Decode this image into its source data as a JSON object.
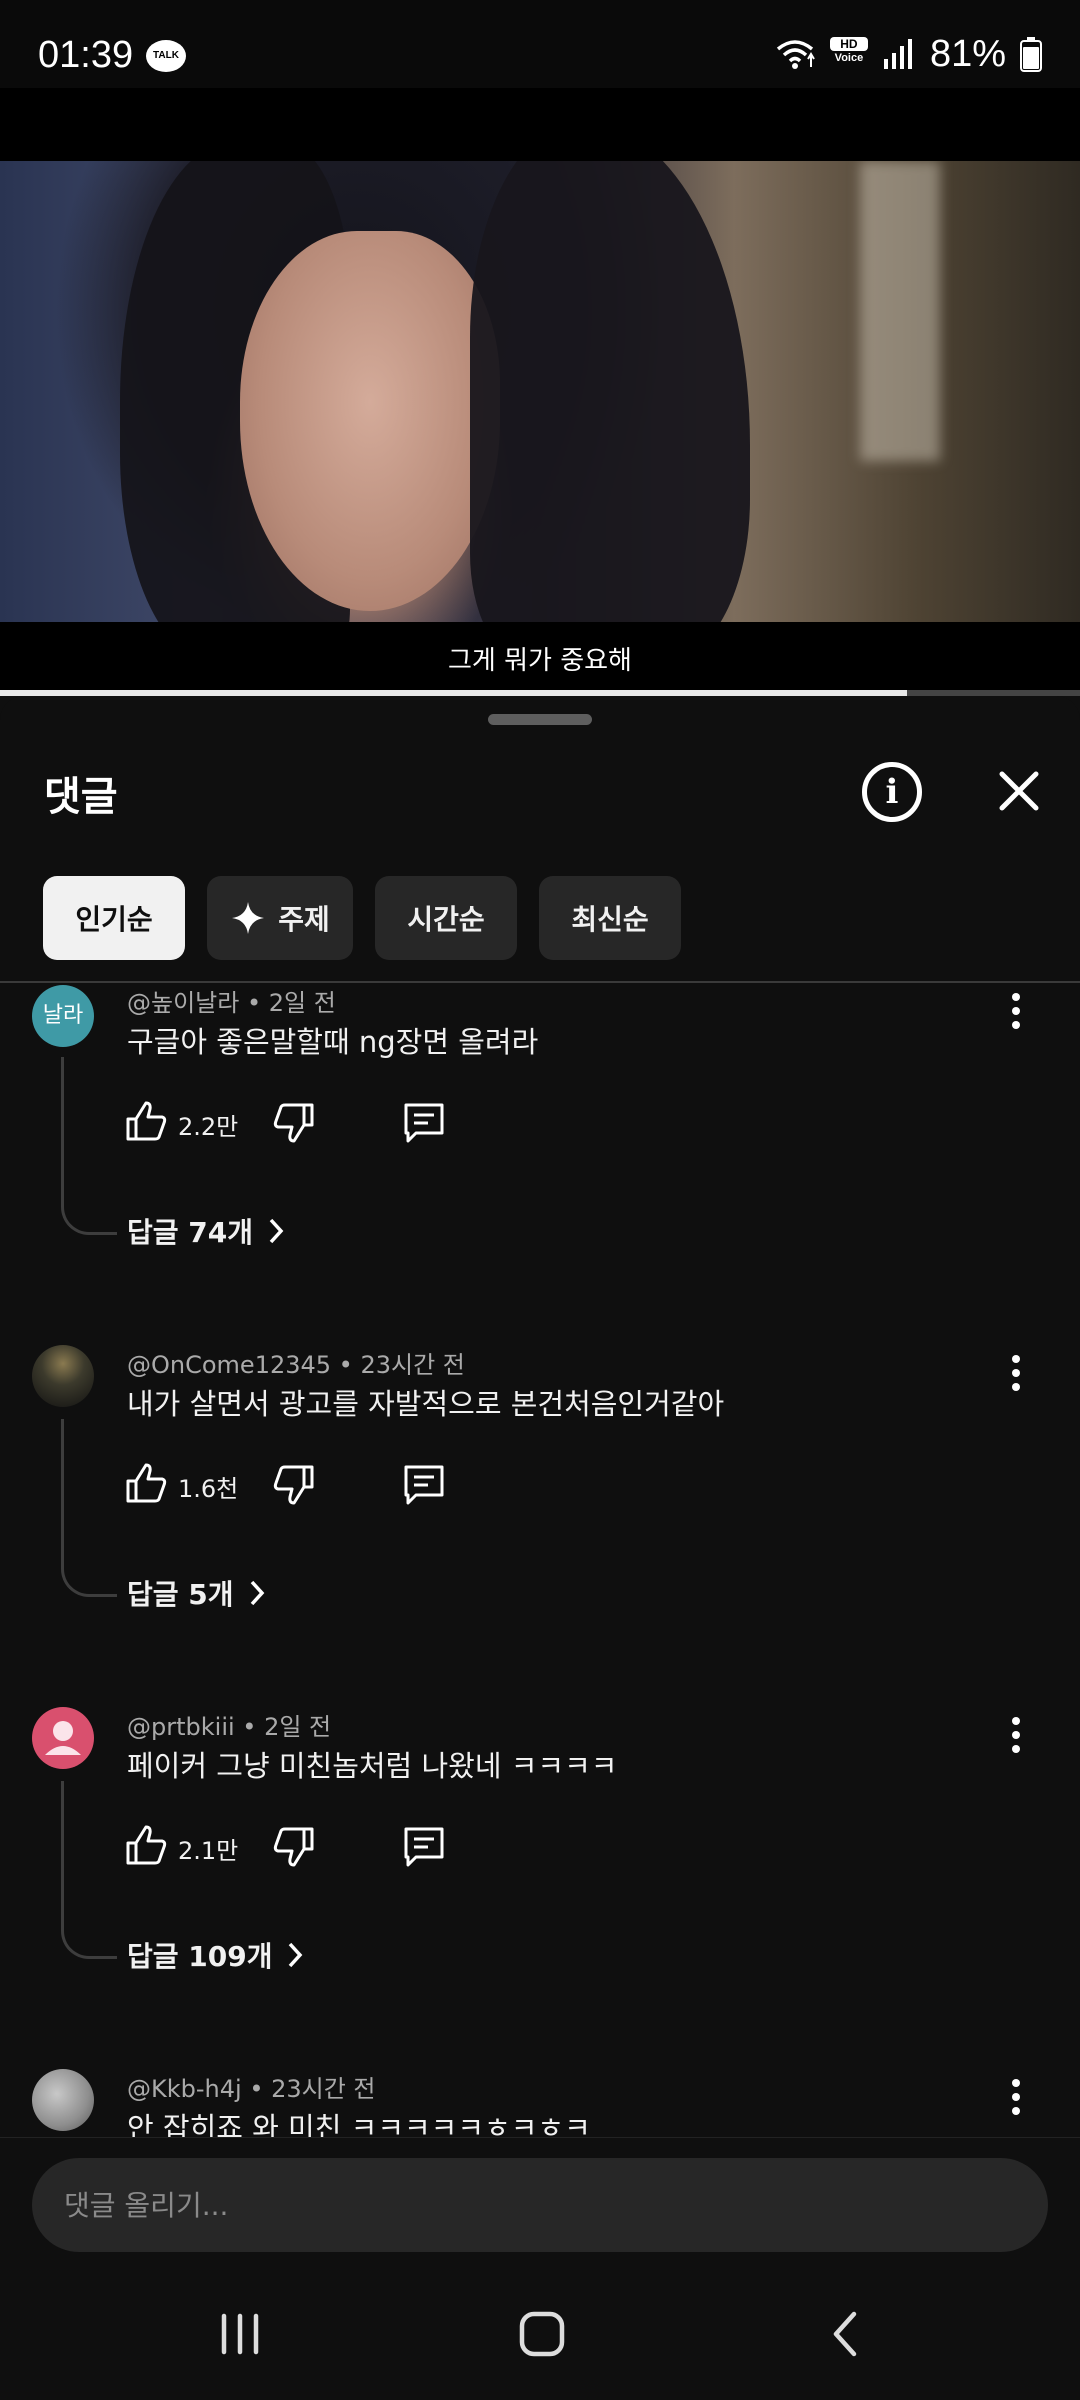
{
  "status_bar": {
    "time": "01:39",
    "talk_badge": "TALK",
    "hd_badge_top": "HD",
    "hd_badge_bottom": "Voice",
    "battery": "81%"
  },
  "video": {
    "subtitle": "그게 뭐가 중요해",
    "progress": 0.84
  },
  "sheet": {
    "title": "댓글",
    "filters": [
      {
        "label": "인기순",
        "active": true
      },
      {
        "label": "주제",
        "active": false
      },
      {
        "label": "시간순",
        "active": false
      },
      {
        "label": "최신순",
        "active": false
      }
    ]
  },
  "comments": [
    {
      "avatar_text": "날라",
      "avatar_color": "#3f9aa6",
      "author": "@높이날라",
      "time": "2일 전",
      "text": "구글아 좋은말할때 ng장면 올려라",
      "likes": "2.2만",
      "replies": "답글 74개"
    },
    {
      "avatar_text": "",
      "avatar_color": "#3c3a2c",
      "author": "@OnCome12345",
      "time": "23시간 전",
      "text": "내가 살면서 광고를 자발적으로 본건처음인거같아",
      "likes": "1.6천",
      "replies": "답글 5개"
    },
    {
      "avatar_text": "",
      "avatar_color": "#d9506e",
      "author": "@prtbkiii",
      "time": "2일 전",
      "text": "페이커 그냥 미친놈처럼 나왔네 ㅋㅋㅋㅋ",
      "likes": "2.1만",
      "replies": "답글 109개"
    },
    {
      "avatar_text": "",
      "avatar_color": "#9a9a9a",
      "author": "@Kkb-h4j",
      "time": "23시간 전",
      "text": "안 잡히죠 와 미친 ㅋㅋㅋㅋㅋㅎㅋㅎㅋ",
      "likes": "",
      "replies": ""
    }
  ],
  "input": {
    "placeholder": "댓글 올리기..."
  },
  "nav": {
    "recents": "recents-icon",
    "home": "home-icon",
    "back": "back-icon"
  }
}
